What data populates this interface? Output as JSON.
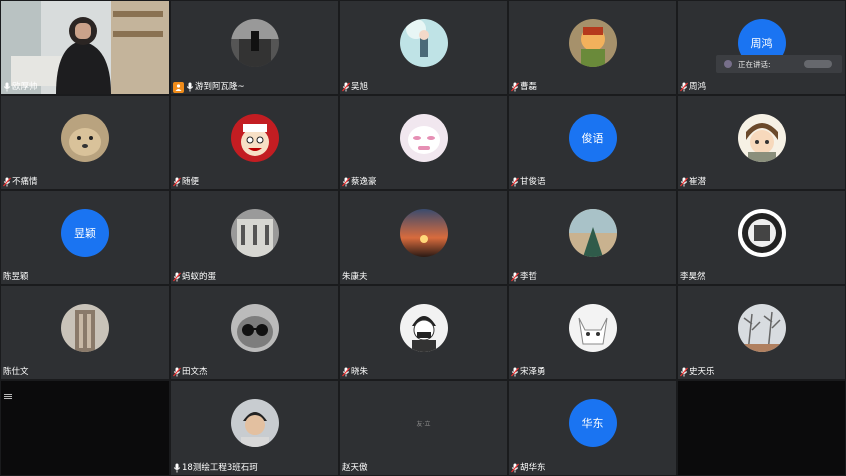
{
  "colors": {
    "tile_bg": "#2e3033",
    "text_avatar_blue": "#1a74f2",
    "host_orange": "#f08c1a"
  },
  "speaking_indicator": {
    "label": "正在讲话:"
  },
  "tiles": [
    {
      "name": "欧厚帅",
      "avatar": "video",
      "avatar_text": "",
      "icon": "mic-icon"
    },
    {
      "name": "游到阿瓦隆~",
      "avatar": "bw-photo",
      "avatar_text": "",
      "icon": "mic-icon",
      "host": true
    },
    {
      "name": "吴旭",
      "avatar": "anime-girl",
      "avatar_text": "",
      "icon": "mic-muted-icon"
    },
    {
      "name": "曹磊",
      "avatar": "cartoon-hero",
      "avatar_text": "",
      "icon": "mic-muted-icon"
    },
    {
      "name": "周鸿",
      "avatar": "text",
      "avatar_text": "周鸿",
      "icon": "mic-muted-icon"
    },
    {
      "name": "不痛情",
      "avatar": "dog",
      "avatar_text": "",
      "icon": "mic-muted-icon"
    },
    {
      "name": "随便",
      "avatar": "red-cartoon",
      "avatar_text": "",
      "icon": "mic-muted-icon"
    },
    {
      "name": "蔡逸豪",
      "avatar": "pink-meme",
      "avatar_text": "",
      "icon": "mic-muted-icon"
    },
    {
      "name": "甘俊语",
      "avatar": "text",
      "avatar_text": "俊语",
      "icon": "mic-muted-icon"
    },
    {
      "name": "崔潜",
      "avatar": "anime-boy",
      "avatar_text": "",
      "icon": "mic-muted-icon"
    },
    {
      "name": "陈昱颖",
      "avatar": "text",
      "avatar_text": "昱颖",
      "icon": "none"
    },
    {
      "name": "蚂蚁的蛋",
      "avatar": "building",
      "avatar_text": "",
      "icon": "mic-muted-icon"
    },
    {
      "name": "朱康夫",
      "avatar": "sunset",
      "avatar_text": "",
      "icon": "none"
    },
    {
      "name": "李哲",
      "avatar": "sky-tree",
      "avatar_text": "",
      "icon": "mic-muted-icon"
    },
    {
      "name": "李昊然",
      "avatar": "badge-logo",
      "avatar_text": "",
      "icon": "none"
    },
    {
      "name": "陈仕文",
      "avatar": "tall-building",
      "avatar_text": "",
      "icon": "none"
    },
    {
      "name": "田文杰",
      "avatar": "cat-sunglasses",
      "avatar_text": "",
      "icon": "mic-muted-icon"
    },
    {
      "name": "晓朱",
      "avatar": "sketch-person",
      "avatar_text": "",
      "icon": "mic-muted-icon"
    },
    {
      "name": "宋泽勇",
      "avatar": "white-cat",
      "avatar_text": "",
      "icon": "mic-muted-icon"
    },
    {
      "name": "史天乐",
      "avatar": "winter-trees",
      "avatar_text": "",
      "icon": "mic-muted-icon"
    },
    {
      "name": "",
      "avatar": "none",
      "avatar_text": "",
      "icon": "none"
    },
    {
      "name": "18测绘工程3班石珂",
      "avatar": "person-photo",
      "avatar_text": "",
      "icon": "mic-icon"
    },
    {
      "name": "赵天傲",
      "avatar": "dark-logo",
      "avatar_text": "友·立",
      "icon": "none"
    },
    {
      "name": "胡华东",
      "avatar": "text",
      "avatar_text": "华东",
      "icon": "mic-muted-icon"
    },
    {
      "name": "",
      "avatar": "none",
      "avatar_text": "",
      "icon": "none"
    }
  ]
}
